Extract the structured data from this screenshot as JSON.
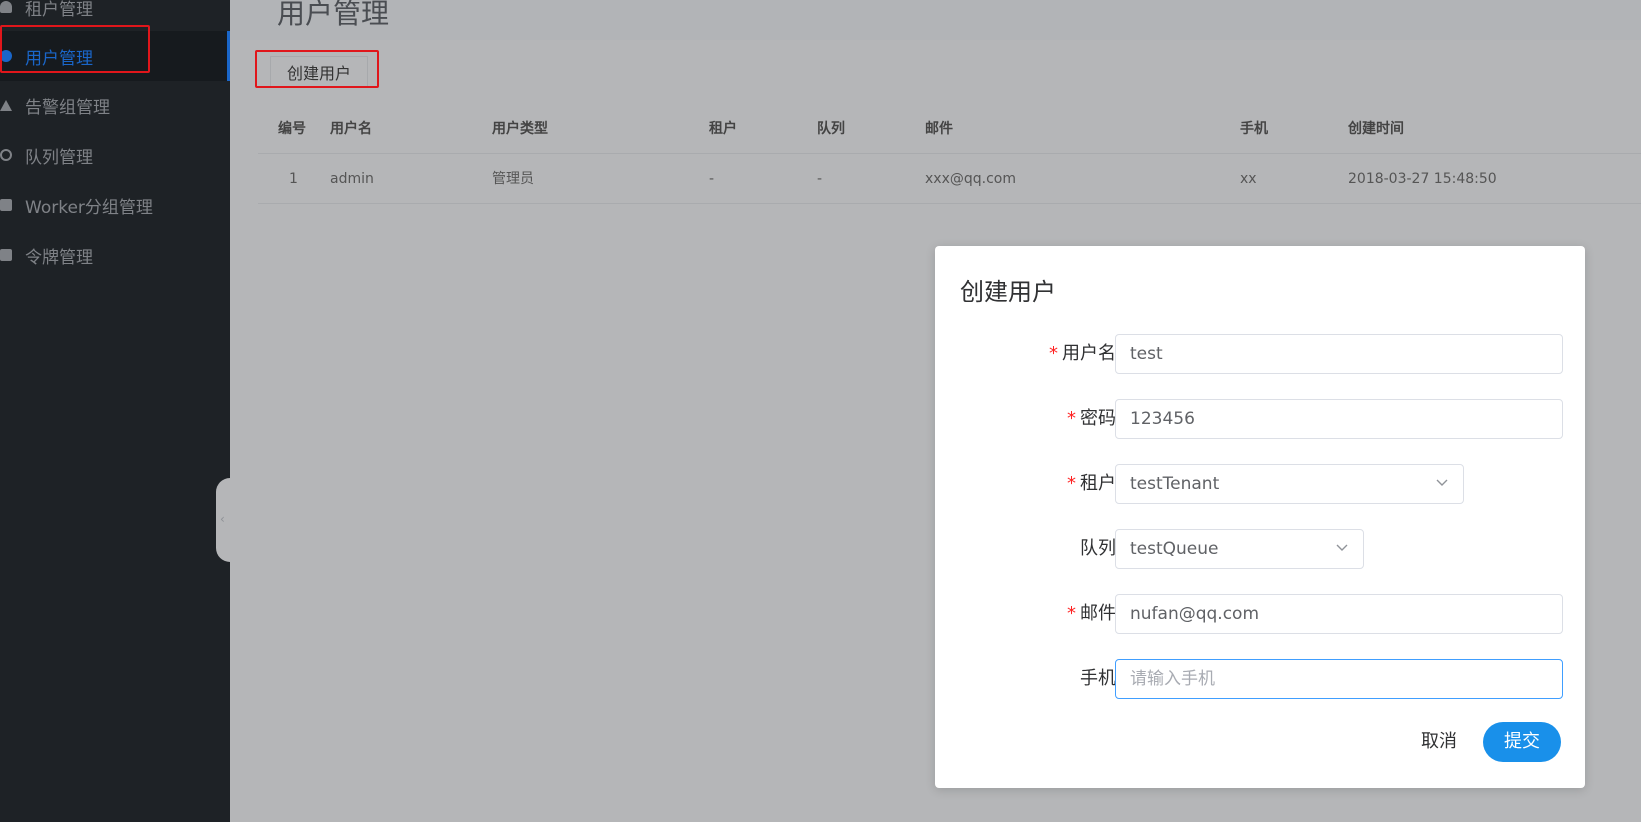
{
  "sidebar": {
    "items": [
      {
        "label": "租户管理",
        "icon": "user-icon"
      },
      {
        "label": "用户管理",
        "icon": "user-circle-icon",
        "active": true
      },
      {
        "label": "告警组管理",
        "icon": "warning-triangle-icon"
      },
      {
        "label": "队列管理",
        "icon": "recycle-icon"
      },
      {
        "label": "Worker分组管理",
        "icon": "badge-icon"
      },
      {
        "label": "令牌管理",
        "icon": "card-icon"
      }
    ],
    "collapse_glyph": "‹"
  },
  "main": {
    "title": "用户管理",
    "create_button": "创建用户",
    "table": {
      "headers": [
        "编号",
        "用户名",
        "用户类型",
        "租户",
        "队列",
        "邮件",
        "手机",
        "创建时间"
      ],
      "rows": [
        [
          "1",
          "admin",
          "管理员",
          "-",
          "-",
          "xxx@qq.com",
          "xx",
          "2018-03-27 15:48:50"
        ]
      ]
    }
  },
  "modal": {
    "title": "创建用户",
    "fields": {
      "username": {
        "label": "用户名",
        "required": "*",
        "value": "test"
      },
      "password": {
        "label": "密码",
        "required": "*",
        "value": "123456"
      },
      "tenant": {
        "label": "租户",
        "required": "*",
        "value": "testTenant"
      },
      "queue": {
        "label": "队列",
        "value": "testQueue"
      },
      "email": {
        "label": "邮件",
        "required": "*",
        "value": "nufan@qq.com"
      },
      "phone": {
        "label": "手机",
        "placeholder": "请输入手机"
      }
    },
    "cancel_label": "取消",
    "submit_label": "提交"
  },
  "colors": {
    "accent": "#1990ea",
    "sidebar_bg": "#1e2226",
    "active_nav": "#1a66c9",
    "highlight_box": "#e0161b",
    "required_star": "#ff2222"
  }
}
